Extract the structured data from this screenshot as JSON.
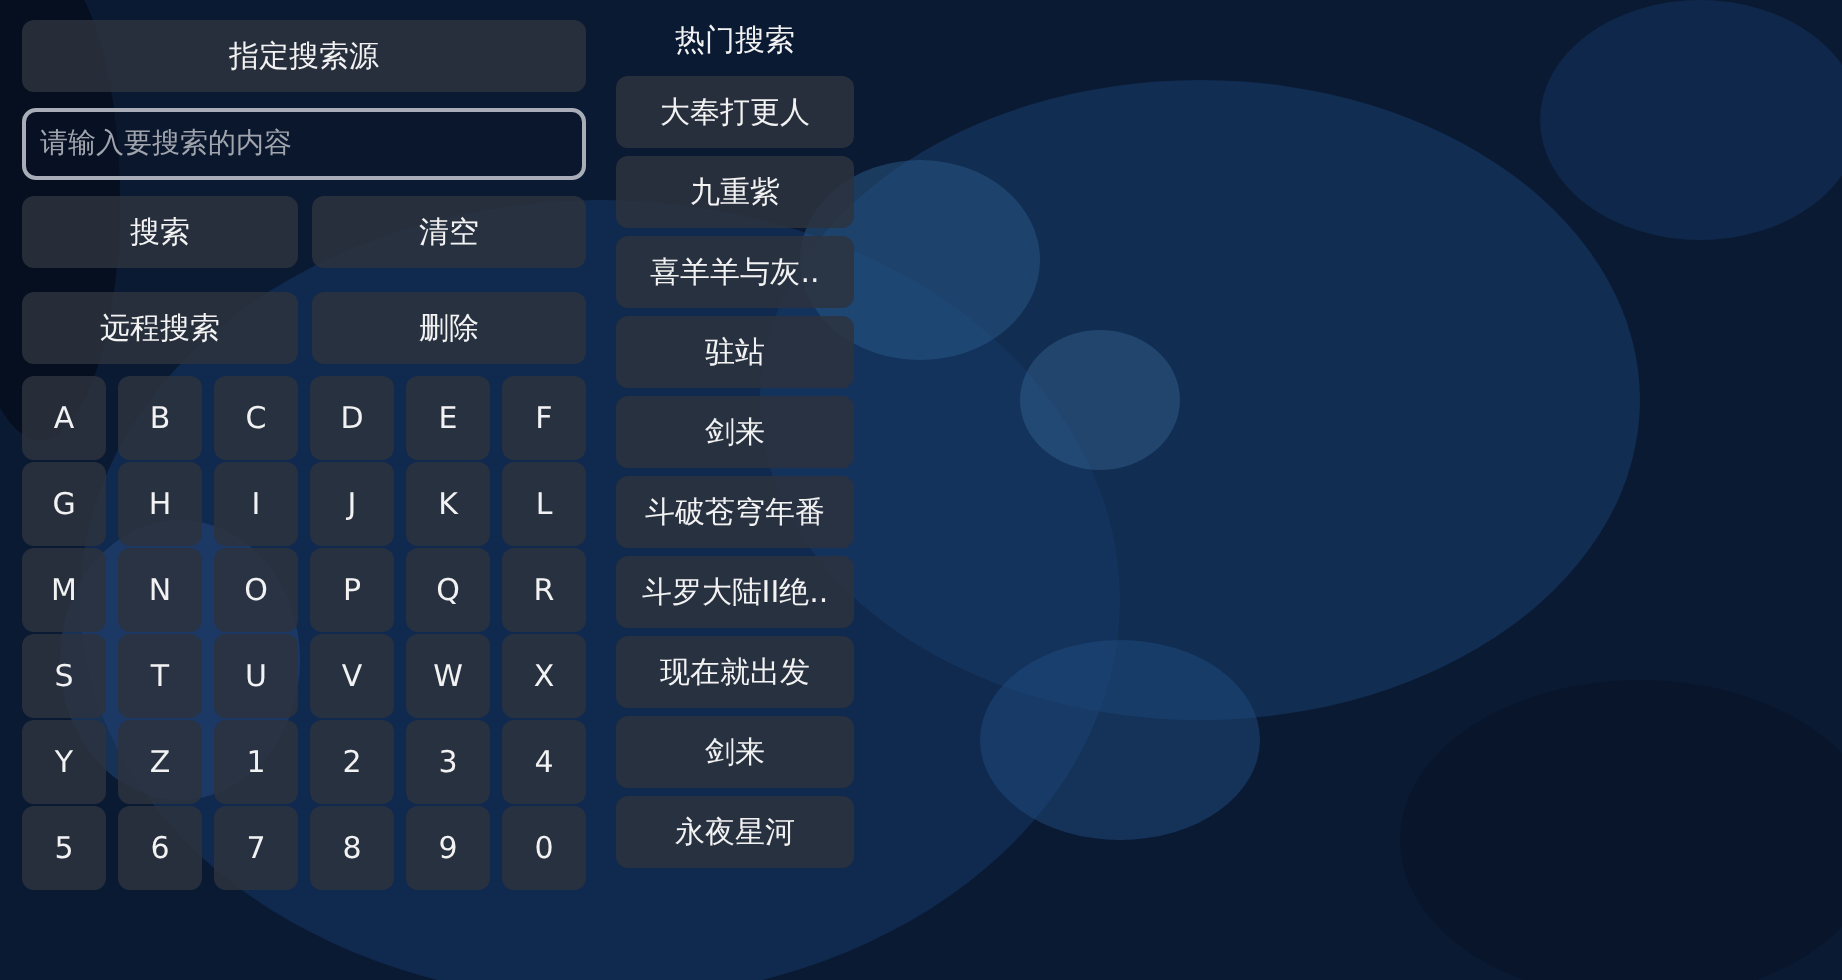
{
  "source_button": "指定搜索源",
  "search_field": {
    "placeholder": "请输入要搜索的内容"
  },
  "actions": [
    {
      "label": "搜索"
    },
    {
      "label": "清空"
    },
    {
      "label": "远程搜索"
    },
    {
      "label": "删除"
    }
  ],
  "keys": [
    "A",
    "B",
    "C",
    "D",
    "E",
    "F",
    "G",
    "H",
    "I",
    "J",
    "K",
    "L",
    "M",
    "N",
    "O",
    "P",
    "Q",
    "R",
    "S",
    "T",
    "U",
    "V",
    "W",
    "X",
    "Y",
    "Z",
    "1",
    "2",
    "3",
    "4",
    "5",
    "6",
    "7",
    "8",
    "9",
    "0"
  ],
  "hot_search": {
    "title": "热门搜索",
    "items": [
      "大奉打更人",
      "九重紫",
      "喜羊羊与灰..",
      "驻站",
      "剑来",
      "斗破苍穹年番",
      "斗罗大陆II绝..",
      "现在就出发",
      "剑来",
      "永夜星河"
    ]
  }
}
